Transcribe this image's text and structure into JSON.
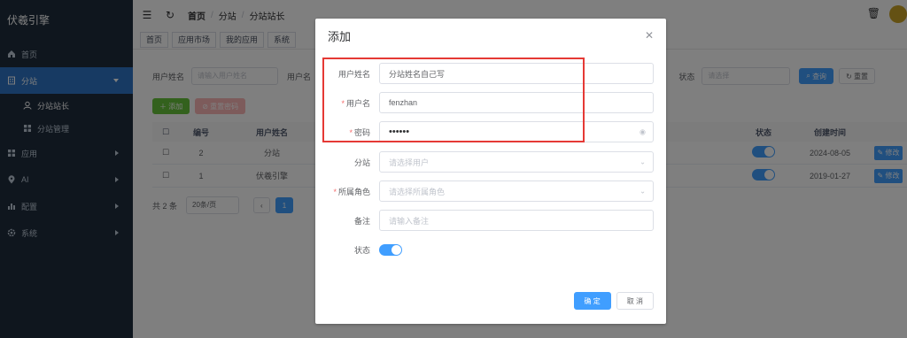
{
  "app": {
    "brand": "伏羲引擎"
  },
  "sidebar": {
    "items": [
      {
        "label": "首页",
        "icon": "home-icon"
      },
      {
        "label": "分站",
        "icon": "building-icon"
      },
      {
        "label": "应用",
        "icon": "grid-icon"
      },
      {
        "label": "AI",
        "icon": "pin-icon"
      },
      {
        "label": "配置",
        "icon": "bar-chart-icon"
      },
      {
        "label": "系统",
        "icon": "gear-icon"
      }
    ],
    "submenu": [
      {
        "label": "分站站长",
        "icon": "user-icon"
      },
      {
        "label": "分站管理",
        "icon": "grid-icon"
      }
    ]
  },
  "navbar": {
    "breadcrumb": [
      "首页",
      "分站",
      "分站站长"
    ]
  },
  "tabs": [
    "首页",
    "应用市场",
    "我的应用",
    "系统"
  ],
  "filter": {
    "username_label": "用户姓名",
    "username_placeholder": "请输入用户姓名",
    "user_label": "用户名",
    "status_label": "状态",
    "status_placeholder": "请选择",
    "search_label": "查询",
    "reset_label": "重置"
  },
  "toolbar": {
    "add_label": "添加",
    "reset_pwd_label": "重置密码"
  },
  "table": {
    "headers": {
      "no": "编号",
      "name": "用户姓名",
      "status": "状态",
      "created": "创建时间"
    },
    "rows": [
      {
        "no": "2",
        "name": "分站",
        "created": "2024-08-05",
        "edit": "修改"
      },
      {
        "no": "1",
        "name": "伏羲引擎",
        "created": "2019-01-27",
        "edit": "修改"
      }
    ]
  },
  "pager": {
    "total": "共 2 条",
    "page_size": "20条/页",
    "page": "1"
  },
  "dialog": {
    "title": "添加",
    "fields": {
      "username_label": "用户姓名",
      "username_value": "分站姓名自己写",
      "user_label": "用户名",
      "user_value": "fenzhan",
      "password_label": "密码",
      "password_value": "••••••",
      "branch_label": "分站",
      "branch_placeholder": "请选择用户",
      "role_label": "所属角色",
      "role_placeholder": "请选择所属角色",
      "remark_label": "备注",
      "remark_placeholder": "请输入备注",
      "status_label": "状态"
    },
    "confirm_label": "确 定",
    "cancel_label": "取 消"
  },
  "colors": {
    "primary": "#409eff",
    "sidebar_bg": "#1f2d3d",
    "active": "#2f75c6",
    "highlight": "#e53935"
  }
}
